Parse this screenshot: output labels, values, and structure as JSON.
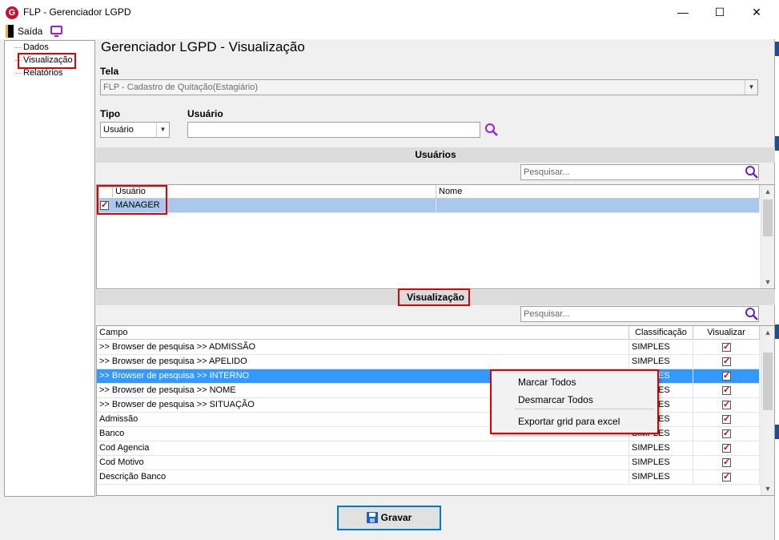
{
  "window": {
    "title": "FLP - Gerenciador LGPD",
    "minimize": "—",
    "maximize": "☐",
    "close": "✕"
  },
  "menu": {
    "exit_label": "Saída"
  },
  "tree": {
    "items": [
      "Dados",
      "Visualização",
      "Relatórios"
    ]
  },
  "page": {
    "title": "Gerenciador LGPD - Visualização"
  },
  "form": {
    "tela_label": "Tela",
    "tela_value": "FLP - Cadastro de Quitação(Estagiário)",
    "tipo_label": "Tipo",
    "tipo_value": "Usuário",
    "usuario_label": "Usuário",
    "usuario_value": ""
  },
  "users": {
    "section_title": "Usuários",
    "search_placeholder": "Pesquisar...",
    "columns": [
      "Usuário",
      "Nome"
    ],
    "rows": [
      {
        "usuario": "MANAGER",
        "nome": "",
        "checked": true
      }
    ]
  },
  "visualizacao": {
    "section_title": "Visualização",
    "search_placeholder": "Pesquisar...",
    "columns": [
      "Campo",
      "Classificação",
      "Visualizar"
    ],
    "rows": [
      {
        "campo": ">> Browser de pesquisa >> ADMISSÃO",
        "classificacao": "SIMPLES",
        "visualizar": true
      },
      {
        "campo": ">> Browser de pesquisa >> APELIDO",
        "classificacao": "SIMPLES",
        "visualizar": true
      },
      {
        "campo": ">> Browser de pesquisa >> INTERNO",
        "classificacao": "SIMPLES",
        "visualizar": true
      },
      {
        "campo": ">> Browser de pesquisa >> NOME",
        "classificacao": "SIMPLES",
        "visualizar": true
      },
      {
        "campo": ">> Browser de pesquisa >> SITUAÇÃO",
        "classificacao": "SIMPLES",
        "visualizar": true
      },
      {
        "campo": "Admissão",
        "classificacao": "SIMPLES",
        "visualizar": true
      },
      {
        "campo": "Banco",
        "classificacao": "SIMPLES",
        "visualizar": true
      },
      {
        "campo": "Cod Agencia",
        "classificacao": "SIMPLES",
        "visualizar": true
      },
      {
        "campo": "Cod Motivo",
        "classificacao": "SIMPLES",
        "visualizar": true
      },
      {
        "campo": "Descrição Banco",
        "classificacao": "SIMPLES",
        "visualizar": true
      }
    ],
    "selected_row": 2
  },
  "context_menu": {
    "items": [
      "Marcar Todos",
      "Desmarcar Todos",
      "Exportar grid para excel"
    ]
  },
  "buttons": {
    "save_label": "Gravar"
  },
  "colors": {
    "highlight": "#e00000",
    "selection": "#3399ff",
    "accent_purple": "#9a1fd8"
  },
  "icons": {
    "app": "flp-logo-icon",
    "exit": "door-exit-icon",
    "screen": "monitor-icon",
    "search": "magnifier-icon",
    "save": "floppy-disk-icon"
  }
}
